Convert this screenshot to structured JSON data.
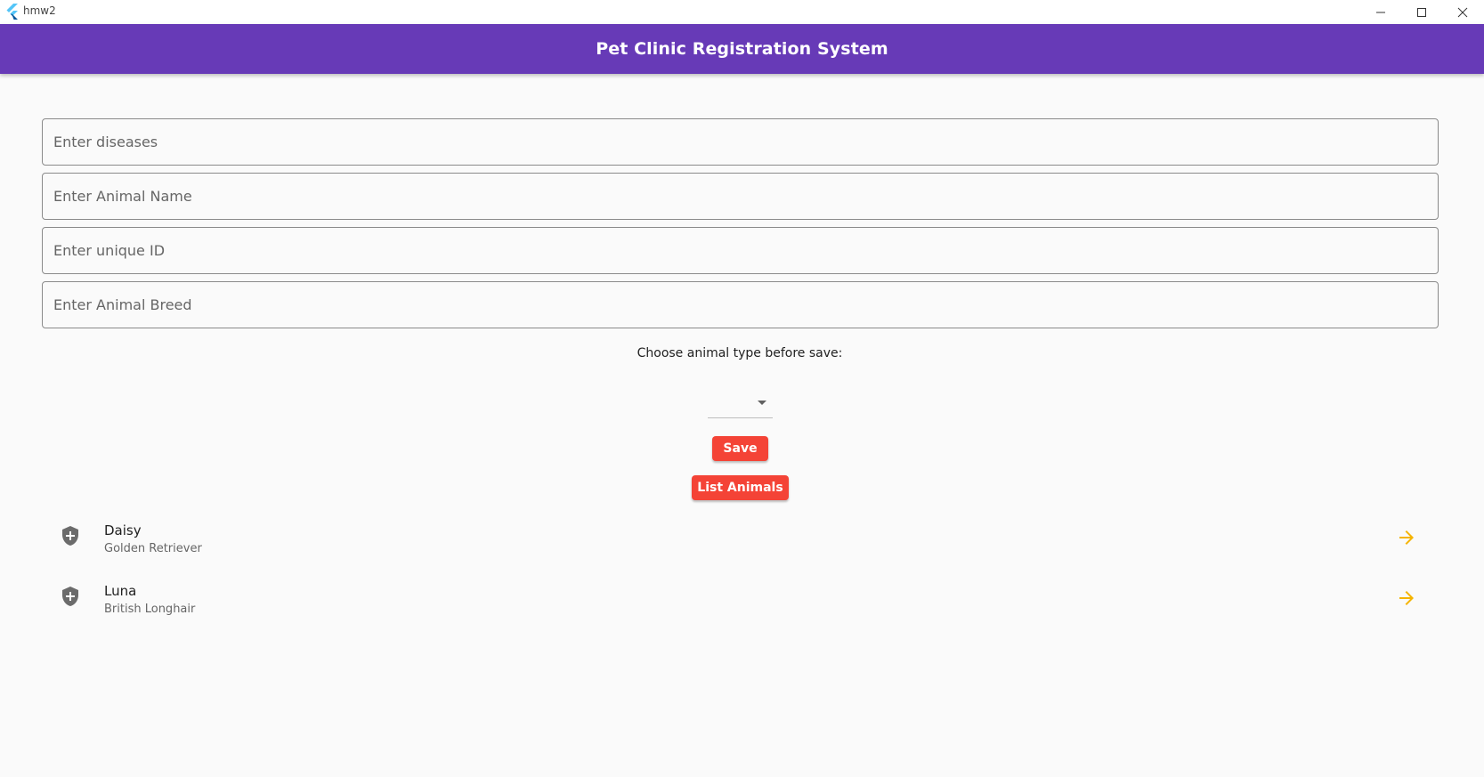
{
  "window": {
    "title": "hmw2"
  },
  "appbar": {
    "title": "Pet Clinic Registration System",
    "color": "#673ab7"
  },
  "form": {
    "diseases_placeholder": "Enter diseases",
    "name_placeholder": "Enter Animal Name",
    "id_placeholder": "Enter unique ID",
    "breed_placeholder": "Enter Animal Breed",
    "type_label": "Choose animal type before save:",
    "type_selected": "",
    "save_label": "Save",
    "list_label": "List Animals",
    "button_color": "#f44336"
  },
  "animals": {
    "items": [
      {
        "name": "Daisy",
        "breed": "Golden Retriever",
        "icon": "shield-plus-icon",
        "action_icon": "arrow-forward-icon"
      },
      {
        "name": "Luna",
        "breed": "British Longhair",
        "icon": "shield-plus-icon",
        "action_icon": "arrow-forward-icon"
      }
    ],
    "arrow_color": "#f5b400"
  }
}
